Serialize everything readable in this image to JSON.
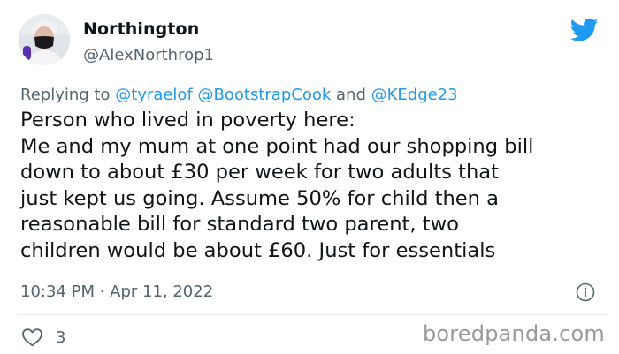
{
  "author": {
    "name": "Northington",
    "handle": "@AlexNorthrop1"
  },
  "reply": {
    "prefix": "Replying to",
    "mention_1": "@tyraelof",
    "mention_2": "@BootstrapCook",
    "conjunction": "and",
    "mention_3": "@KEdge23"
  },
  "tweet": {
    "lines": [
      "Person who lived in poverty here:",
      "Me and my mum at one point had our shopping bill",
      "down to about £30 per week for two adults that",
      "just kept us going. Assume 50% for child then a",
      "reasonable bill for standard two parent, two",
      "children would be about £60. Just for essentials"
    ],
    "timestamp": "10:34 PM · Apr 11, 2022"
  },
  "actions": {
    "like_count": "3"
  },
  "watermark": "boredpanda.com",
  "colors": {
    "twitter_blue": "#1d9bf0",
    "muted_text": "#536471",
    "body_text": "#0f1419"
  },
  "icons": {
    "brand": "twitter-bird-icon",
    "info": "info-icon",
    "like": "heart-icon"
  }
}
